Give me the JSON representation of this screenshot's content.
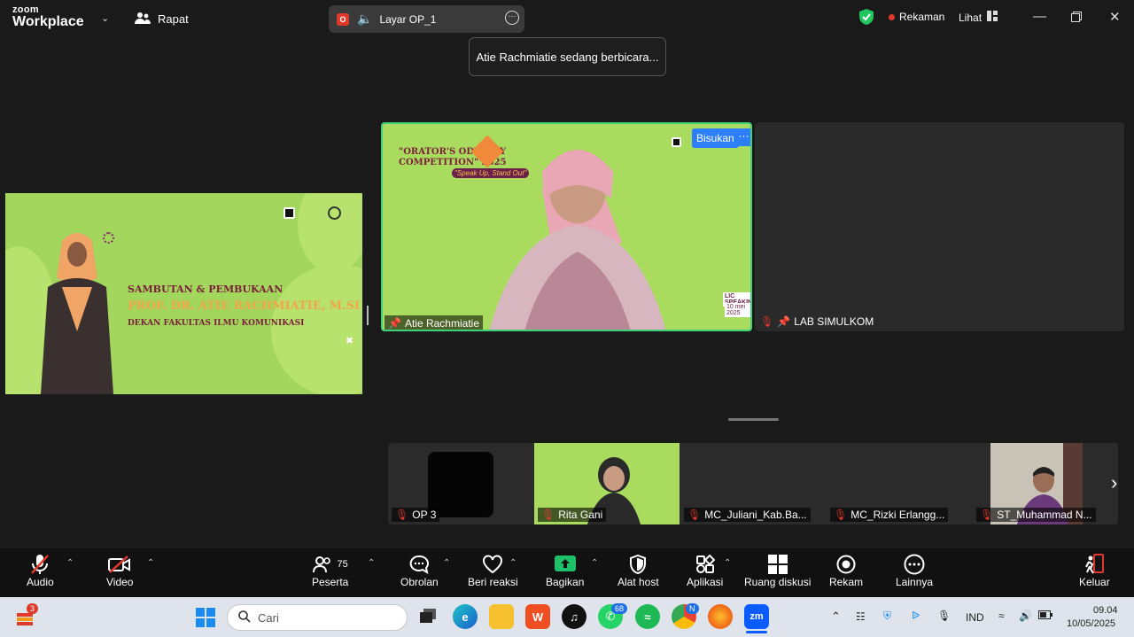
{
  "app": {
    "logo_line1": "zoom",
    "logo_line2": "Workplace"
  },
  "meeting": {
    "label": "Rapat"
  },
  "share": {
    "label": "Layar OP_1",
    "rec_letter": "O"
  },
  "toast": "Atie Rachmiatie sedang berbicara...",
  "recording": {
    "label": "Rekaman"
  },
  "view": {
    "label": "Lihat"
  },
  "slide": {
    "line1": "SAMBUTAN & PEMBUKAAN",
    "line2": "PROF. DR. ATIE RACHMIATIE, M.SI",
    "line3": "DEKAN FAKULTAS ILMU KOMUNIKASI"
  },
  "speaker": {
    "name": "Atie Rachmiatie",
    "mute_label": "Bisukan",
    "more_label": "···",
    "banner1": "\"ORATOR'S ODYSSEY",
    "banner2": "COMPETITION\" 2025",
    "banner3": "\"Speak Up, Stand Out\"",
    "corner": "LIC SPEAKING",
    "corner_date": "10 mei 2025"
  },
  "second_tile": {
    "name": "LAB SIMULKOM"
  },
  "filmstrip": [
    {
      "name": "OP 3"
    },
    {
      "name": "Rita Gani"
    },
    {
      "name": "MC_Juliani_Kab.Ba..."
    },
    {
      "name": "MC_Rizki Erlangg..."
    },
    {
      "name": "ST_Muhammad N..."
    }
  ],
  "toolbar": {
    "audio": "Audio",
    "video": "Video",
    "participants": "Peserta",
    "participant_count": "75",
    "chat": "Obrolan",
    "react": "Beri reaksi",
    "share": "Bagikan",
    "host_tools": "Alat host",
    "apps": "Aplikasi",
    "breakout": "Ruang diskusi",
    "record": "Rekam",
    "more": "Lainnya",
    "leave": "Keluar"
  },
  "taskbar": {
    "search_placeholder": "Cari",
    "weather_badge": "3",
    "whatsapp_badge": "68",
    "chrome_badge": "N",
    "lang": "IND",
    "time": "09.04",
    "date": "10/05/2025"
  },
  "colors": {
    "active_speaker_border": "#3fd07a",
    "accent_blue": "#2d7ff9",
    "slide_green": "#a3d65d",
    "share_green": "#1fc06a",
    "recording_red": "#e0392b"
  }
}
